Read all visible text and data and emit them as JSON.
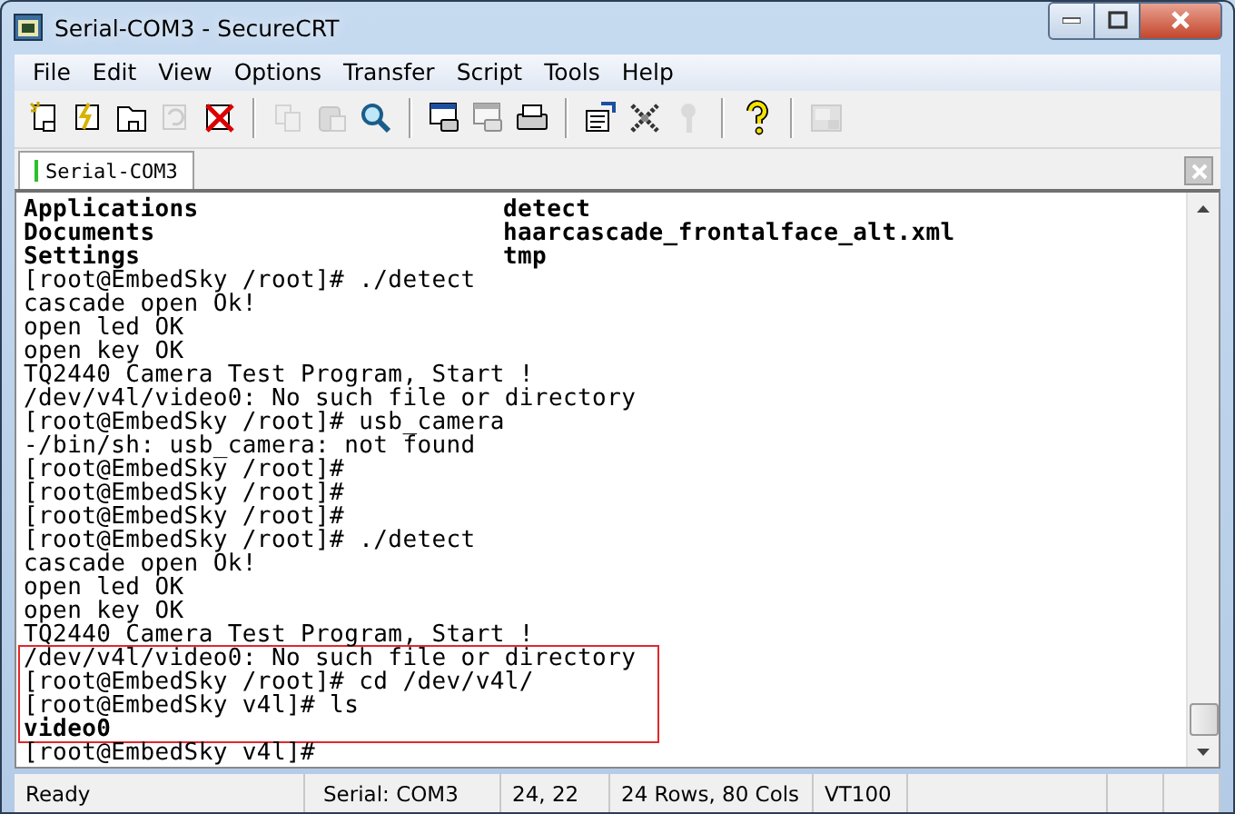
{
  "window": {
    "title": "Serial-COM3 - SecureCRT"
  },
  "menu": [
    "File",
    "Edit",
    "View",
    "Options",
    "Transfer",
    "Script",
    "Tools",
    "Help"
  ],
  "toolbar": [
    {
      "kind": "connect",
      "disabled": false
    },
    {
      "kind": "quick-connect",
      "disabled": false
    },
    {
      "kind": "folder",
      "disabled": false
    },
    {
      "kind": "reconnect",
      "disabled": true
    },
    {
      "kind": "disconnect",
      "disabled": false
    },
    {
      "kind": "separator"
    },
    {
      "kind": "copy",
      "disabled": true
    },
    {
      "kind": "paste",
      "disabled": true
    },
    {
      "kind": "find",
      "disabled": false
    },
    {
      "kind": "separator"
    },
    {
      "kind": "print-window",
      "disabled": false
    },
    {
      "kind": "print-window",
      "disabled": true
    },
    {
      "kind": "printer",
      "disabled": false
    },
    {
      "kind": "separator"
    },
    {
      "kind": "properties",
      "disabled": false
    },
    {
      "kind": "tools",
      "disabled": false
    },
    {
      "kind": "key",
      "disabled": true
    },
    {
      "kind": "separator"
    },
    {
      "kind": "help",
      "disabled": false
    },
    {
      "kind": "separator"
    },
    {
      "kind": "monitor",
      "disabled": true
    }
  ],
  "tabs": [
    {
      "label": "Serial-COM3",
      "selected": true
    }
  ],
  "terminal": {
    "lines": [
      {
        "kind": "listing",
        "cells": [
          "Applications",
          "detect"
        ]
      },
      {
        "kind": "listing",
        "cells": [
          "Documents",
          "haarcascade_frontalface_alt.xml"
        ]
      },
      {
        "kind": "listing",
        "cells": [
          "Settings",
          "tmp"
        ]
      },
      {
        "kind": "text",
        "text": "[root@EmbedSky /root]# ./detect"
      },
      {
        "kind": "text",
        "text": "cascade open Ok!"
      },
      {
        "kind": "text",
        "text": "open led OK"
      },
      {
        "kind": "text",
        "text": "open key OK"
      },
      {
        "kind": "text",
        "text": "TQ2440 Camera Test Program, Start !"
      },
      {
        "kind": "text",
        "text": "/dev/v4l/video0: No such file or directory"
      },
      {
        "kind": "text",
        "text": "[root@EmbedSky /root]# usb_camera"
      },
      {
        "kind": "text",
        "text": "-/bin/sh: usb_camera: not found"
      },
      {
        "kind": "text",
        "text": "[root@EmbedSky /root]#"
      },
      {
        "kind": "text",
        "text": "[root@EmbedSky /root]#"
      },
      {
        "kind": "text",
        "text": "[root@EmbedSky /root]#"
      },
      {
        "kind": "text",
        "text": "[root@EmbedSky /root]# ./detect"
      },
      {
        "kind": "text",
        "text": "cascade open Ok!"
      },
      {
        "kind": "text",
        "text": "open led OK"
      },
      {
        "kind": "text",
        "text": "open key OK"
      },
      {
        "kind": "text",
        "text": "TQ2440 Camera Test Program, Start !"
      },
      {
        "kind": "highlight",
        "lines": [
          {
            "kind": "text",
            "text": "/dev/v4l/video0: No such file or directory"
          },
          {
            "kind": "text",
            "text": "[root@EmbedSky /root]# cd /dev/v4l/"
          },
          {
            "kind": "text",
            "text": "[root@EmbedSky v4l]# ls"
          },
          {
            "kind": "bold",
            "text": "video0"
          }
        ]
      },
      {
        "kind": "text",
        "text": "[root@EmbedSky v4l]#"
      }
    ]
  },
  "status_bar": [
    "Ready",
    "Serial: COM3",
    "24,  22",
    "24 Rows, 80 Cols",
    "VT100"
  ]
}
